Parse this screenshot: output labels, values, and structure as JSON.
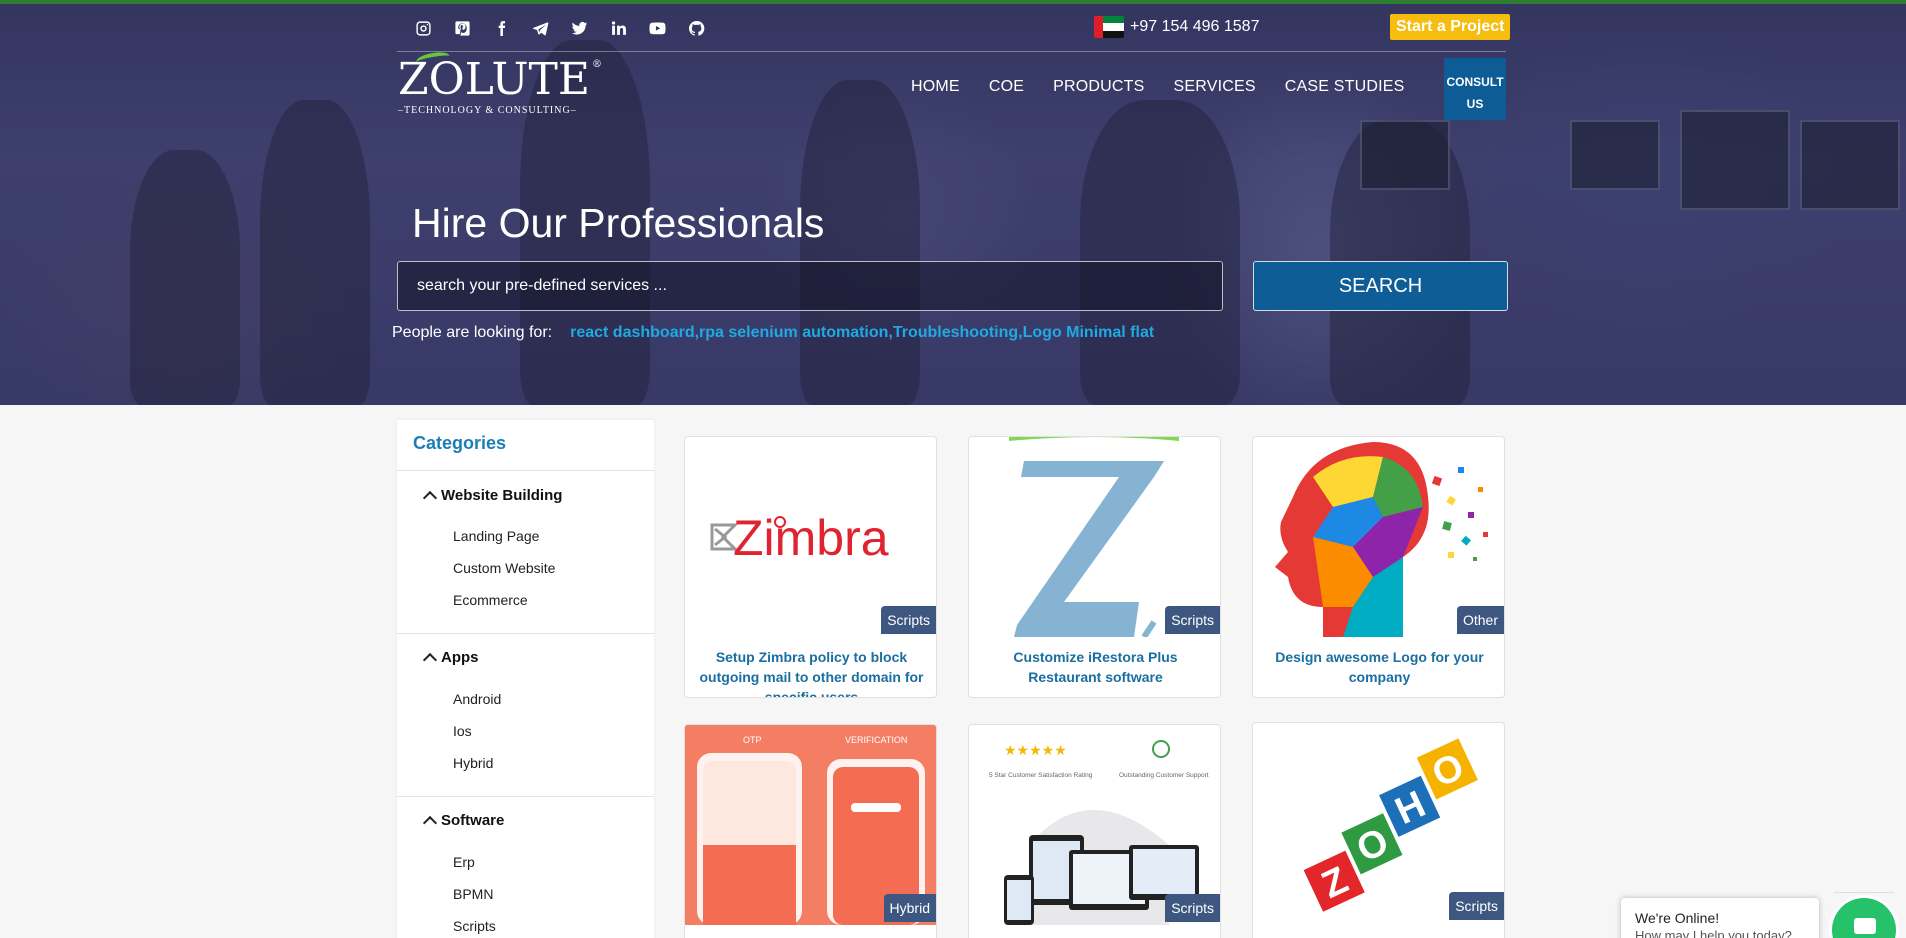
{
  "topbar": {
    "social_icons": [
      "instagram-icon",
      "pinterest-icon",
      "facebook-icon",
      "telegram-icon",
      "twitter-icon",
      "linkedin-icon",
      "youtube-icon",
      "github-icon"
    ],
    "phone": "+97 154 496 1587",
    "start_project": "Start a Project"
  },
  "logo": {
    "word": "ZOLUTE",
    "tagline": "TECHNOLOGY & CONSULTING",
    "reg": "®"
  },
  "nav": [
    "HOME",
    "COE",
    "PRODUCTS",
    "SERVICES",
    "CASE STUDIES"
  ],
  "consult": {
    "line1": "CONSULT",
    "line2": "US"
  },
  "hero": {
    "title": "Hire Our Professionals",
    "search_placeholder": "search your pre-defined services ...",
    "search_button": "SEARCH",
    "looking_label": "People are looking for:",
    "looking_links": "react dashboard,rpa selenium automation,Troubleshooting,Logo Minimal flat"
  },
  "sidebar": {
    "title": "Categories",
    "groups": [
      {
        "label": "Website Building",
        "items": [
          "Landing Page",
          "Custom Website",
          "Ecommerce"
        ]
      },
      {
        "label": "Apps",
        "items": [
          "Android",
          "Ios",
          "Hybrid"
        ]
      },
      {
        "label": "Software",
        "items": [
          "Erp",
          "BPMN",
          "Scripts"
        ]
      }
    ]
  },
  "cards": [
    {
      "badge": "Scripts",
      "title": "Setup Zimbra policy to block outgoing mail to other domain for specific users",
      "image": "zimbra-logo"
    },
    {
      "badge": "Scripts",
      "title": "Customize iRestora Plus Restaurant software",
      "image": "z-letter-logo"
    },
    {
      "badge": "Other",
      "title": "Design awesome Logo for your company",
      "image": "colorful-head-logo"
    },
    {
      "badge": "Hybrid",
      "title": "",
      "image": "otp-verification-app"
    },
    {
      "badge": "Scripts",
      "title": "",
      "image": "customer-support-devices"
    },
    {
      "badge": "Scripts",
      "title": "",
      "image": "zoho-logo"
    }
  ],
  "card_images": {
    "zimbra_text": "Zimbra",
    "otp_label": "OTP",
    "verification_label": "VERIFICATION",
    "satisfaction_text": "5 Star Customer Satisfaction Rating",
    "support_text": "Outstanding Customer Support",
    "zoho_letters": [
      "Z",
      "O",
      "H",
      "O"
    ]
  },
  "chat": {
    "title": "We're Online!",
    "subtitle": "How may I help you today?"
  },
  "colors": {
    "accent": "#1a7fb5",
    "button": "#0e5d97",
    "start": "#f6bd0f",
    "badge": "#3d5780",
    "link": "#21a9e1"
  }
}
